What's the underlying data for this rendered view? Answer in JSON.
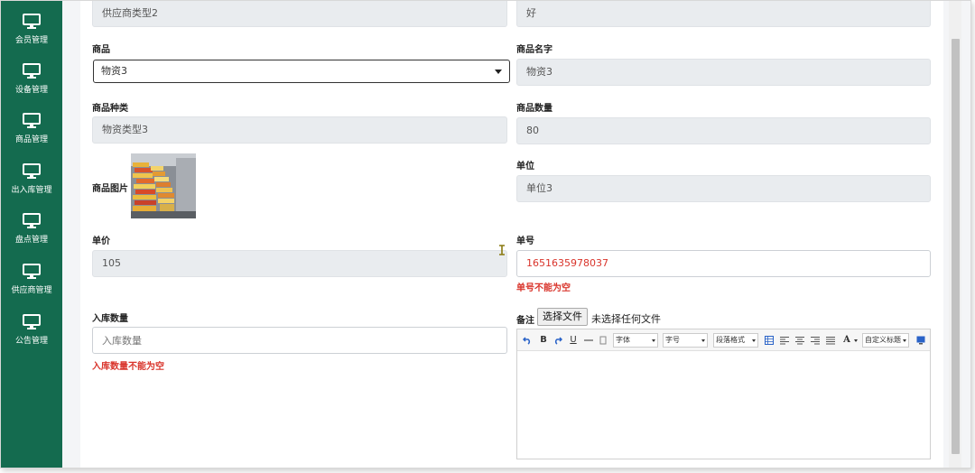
{
  "sidebar": {
    "items": [
      {
        "label": "会员管理"
      },
      {
        "label": "设备管理"
      },
      {
        "label": "商品管理"
      },
      {
        "label": "出入库管理"
      },
      {
        "label": "盘点管理"
      },
      {
        "label": "供应商管理"
      },
      {
        "label": "公告管理"
      }
    ],
    "color": "#146b4f"
  },
  "form": {
    "supplier_type_value": "供应商类型2",
    "top_right_value": "好",
    "goods_label": "商品",
    "goods_selected": "物资3",
    "goods_name_label": "商品名字",
    "goods_name_value": "物资3",
    "goods_kind_label": "商品种类",
    "goods_kind_value": "物资类型3",
    "goods_qty_label": "商品数量",
    "goods_qty_value": "80",
    "goods_image_label": "商品图片",
    "unit_label": "单位",
    "unit_value": "单位3",
    "price_label": "单价",
    "price_value": "105",
    "order_no_label": "单号",
    "order_no_value": "1651635978037",
    "order_no_error": "单号不能为空",
    "stock_in_label": "入库数量",
    "stock_in_placeholder": "入库数量",
    "stock_in_error": "入库数量不能为空",
    "remark_label": "备注",
    "file_button": "选择文件",
    "file_none": "未选择任何文件"
  },
  "editor": {
    "font_family": "字体",
    "font_size": "字号",
    "paragraph": "段落格式",
    "custom_title": "自定义标题",
    "bold": "B",
    "underline": "U",
    "font_color": "A"
  },
  "colors": {
    "error": "#d9342b",
    "readonly_bg": "#e9ecef"
  }
}
